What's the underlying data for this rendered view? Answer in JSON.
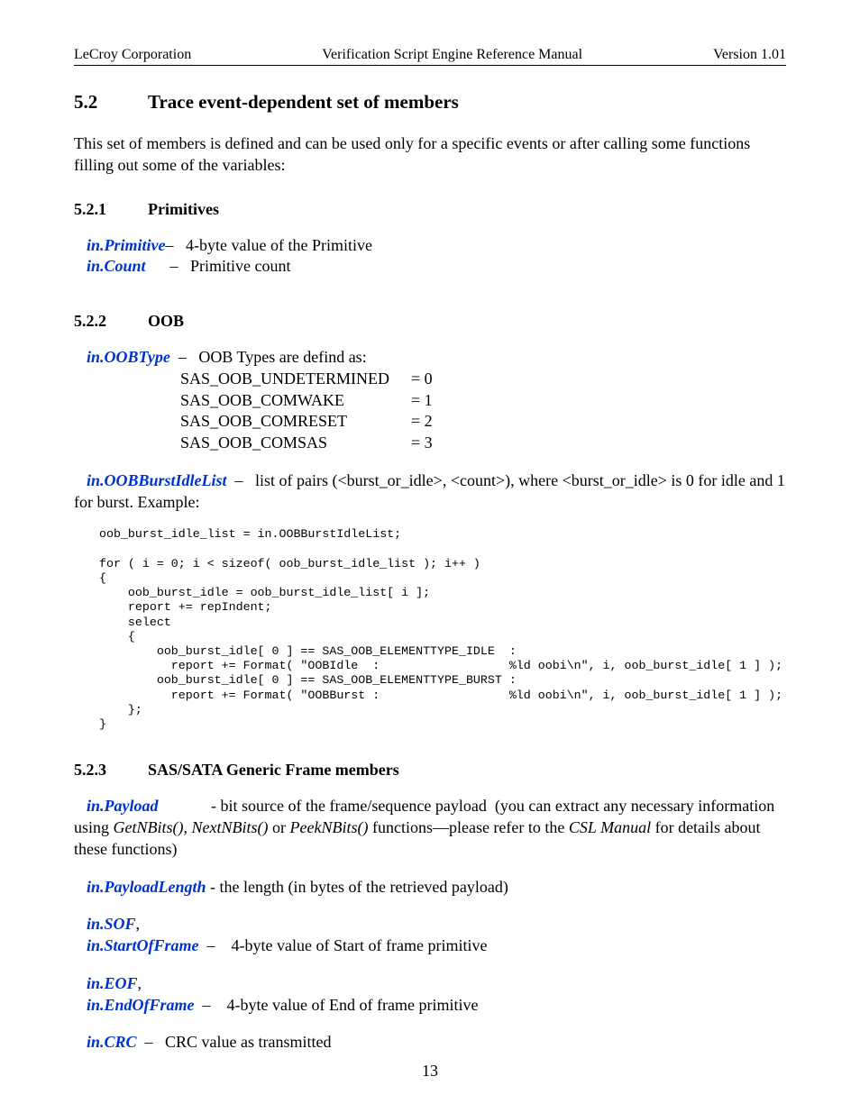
{
  "header": {
    "left": "LeCroy Corporation",
    "center": "Verification Script Engine Reference Manual",
    "right": "Version 1.01"
  },
  "sec52": {
    "num": "5.2",
    "title": "Trace event-dependent set of members",
    "intro": "This set of members is defined and can be used only for a specific events or after calling some functions filling out some of the variables:"
  },
  "sec521": {
    "num": "5.2.1",
    "title": "Primitives",
    "m1_name": "in.Primitive",
    "m1_desc": "–   4-byte value of the Primitive",
    "m2_name": "in.Count",
    "m2_desc": "      –   Primitive count"
  },
  "sec522": {
    "num": "5.2.2",
    "title": "OOB",
    "m1_name": "in.OOBType",
    "m1_desc": "  –   OOB Types are defind as:",
    "types": [
      {
        "name": "SAS_OOB_UNDETERMINED",
        "val": "= 0"
      },
      {
        "name": "SAS_OOB_COMWAKE",
        "val": "= 1"
      },
      {
        "name": "SAS_OOB_COMRESET",
        "val": "= 2"
      },
      {
        "name": "SAS_OOB_COMSAS",
        "val": "= 3"
      }
    ],
    "m2_name": "in.OOBBurstIdleList",
    "m2_desc": "  –   list of pairs (<burst_or_idle>, <count>), where <burst_or_idle> is 0 for idle and 1 for burst. Example:",
    "code": "oob_burst_idle_list = in.OOBBurstIdleList;\n\nfor ( i = 0; i < sizeof( oob_burst_idle_list ); i++ )\n{\n    oob_burst_idle = oob_burst_idle_list[ i ];\n    report += repIndent;\n    select\n    {\n        oob_burst_idle[ 0 ] == SAS_OOB_ELEMENTTYPE_IDLE  :\n          report += Format( \"OOBIdle  :                  %ld oobi\\n\", i, oob_burst_idle[ 1 ] );\n        oob_burst_idle[ 0 ] == SAS_OOB_ELEMENTTYPE_BURST :\n          report += Format( \"OOBBurst :                  %ld oobi\\n\", i, oob_burst_idle[ 1 ] );\n    };\n}"
  },
  "sec523": {
    "num": "5.2.3",
    "title": "SAS/SATA Generic Frame members",
    "m1_name": "in.Payload",
    "m1_mid": "             - bit source of the frame/sequence payload  (you can extract any necessary information using ",
    "m1_f1": "GetNBits()",
    "m1_c1": ", ",
    "m1_f2": "NextNBits()",
    "m1_c2": " or ",
    "m1_f3": "PeekNBits()",
    "m1_c3": " functions—please refer to the ",
    "m1_f4": "CSL Manual",
    "m1_end": " for details about these functions)",
    "m2_name": "in.PayloadLength",
    "m2_desc": " - the length (in bytes of the retrieved payload)",
    "m3a_name": "in.SOF",
    "m3a_sep": ",",
    "m3b_name": "in.StartOfFrame",
    "m3b_desc": "  –    4-byte value of Start of frame primitive",
    "m4a_name": "in.EOF",
    "m4a_sep": ",",
    "m4b_name": "in.EndOfFrame",
    "m4b_desc": "  –    4-byte value of End of frame primitive",
    "m5_name": "in.CRC",
    "m5_desc": "  –   CRC value as transmitted"
  },
  "pagenum": "13"
}
